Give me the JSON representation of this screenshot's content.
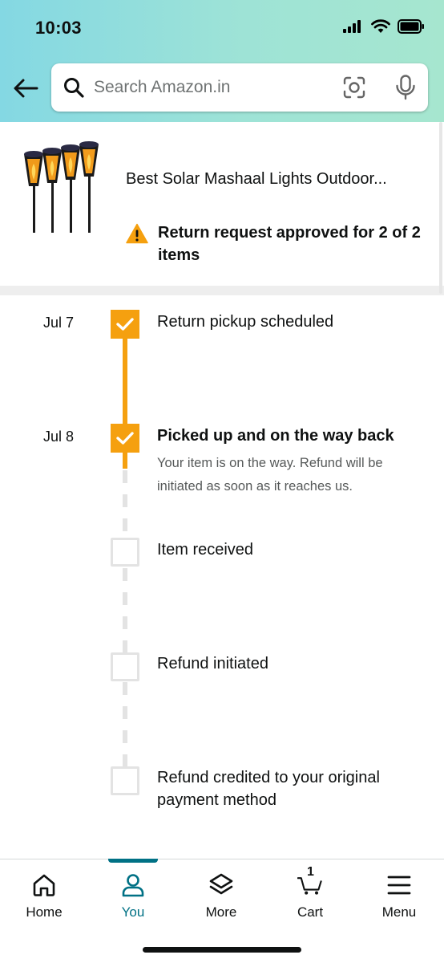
{
  "status_bar": {
    "time": "10:03"
  },
  "header": {
    "search": {
      "placeholder": "Search Amazon.in"
    }
  },
  "product": {
    "title": "Best Solar Mashaal Lights Outdoor...",
    "return_status": "Return request approved for 2 of 2 items"
  },
  "timeline": {
    "steps": [
      {
        "date": "Jul 7",
        "title": "Return pickup scheduled",
        "completed": true
      },
      {
        "date": "Jul 8",
        "title": "Picked up and on the way back",
        "description": "Your item is on the way. Refund will be initiated as soon as it reaches us.",
        "completed": true
      },
      {
        "date": "",
        "title": "Item received",
        "completed": false
      },
      {
        "date": "",
        "title": "Refund initiated",
        "completed": false
      },
      {
        "date": "",
        "title": "Refund credited to your original payment method",
        "completed": false
      }
    ]
  },
  "bottom_nav": {
    "items": [
      {
        "label": "Home",
        "icon": "home-icon",
        "active": false
      },
      {
        "label": "You",
        "icon": "user-icon",
        "active": true
      },
      {
        "label": "More",
        "icon": "layers-icon",
        "active": false
      },
      {
        "label": "Cart",
        "icon": "cart-icon",
        "active": false
      },
      {
        "label": "Menu",
        "icon": "menu-icon",
        "active": false
      }
    ],
    "cart_count": "1"
  },
  "colors": {
    "accent_orange": "#f5a00f",
    "active_teal": "#007185",
    "header_gradient_start": "#84d8e3",
    "header_gradient_end": "#a6e6cf"
  }
}
